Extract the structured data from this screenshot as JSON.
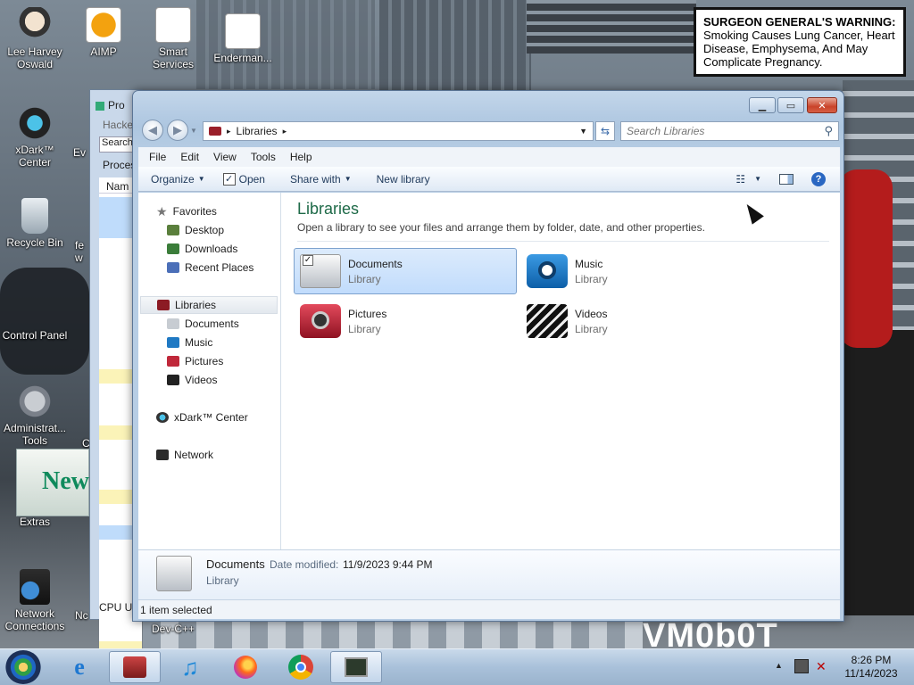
{
  "desktop": {
    "warning_title": "SURGEON GENERAL'S WARNING:",
    "warning_text": "Smoking Causes Lung Cancer, Heart Disease, Emphysema, And May Complicate Pregnancy.",
    "icons": [
      {
        "label": "Lee Harvey Oswald"
      },
      {
        "label": "AIMP"
      },
      {
        "label": "Smart Services"
      },
      {
        "label": "Enderman..."
      },
      {
        "label": "xDark™ Center"
      },
      {
        "label": "Recycle Bin"
      },
      {
        "label": "Control Panel"
      },
      {
        "label": "Administrat... Tools"
      },
      {
        "label": "Extras"
      },
      {
        "label": "Network Connections"
      },
      {
        "label": "Dev-C++"
      }
    ],
    "partial_labels": [
      "Ev",
      "fe",
      "w",
      "C",
      "Nc"
    ],
    "bg_window": {
      "title": "Pro",
      "tab": "Hacke",
      "search": "Search",
      "tab2": "Proces",
      "header": "Nam",
      "status": "CPU Us"
    }
  },
  "explorer": {
    "address": {
      "crumb": "Libraries"
    },
    "search": {
      "placeholder": "Search Libraries"
    },
    "menu": [
      "File",
      "Edit",
      "View",
      "Tools",
      "Help"
    ],
    "commands": {
      "organize": "Organize",
      "open": "Open",
      "share": "Share with",
      "new_library": "New library"
    },
    "nav": {
      "favorites": "Favorites",
      "desktop": "Desktop",
      "downloads": "Downloads",
      "recent": "Recent Places",
      "libraries": "Libraries",
      "documents": "Documents",
      "music": "Music",
      "pictures": "Pictures",
      "videos": "Videos",
      "xdark": "xDark™ Center",
      "network": "Network"
    },
    "content": {
      "title": "Libraries",
      "subtitle": "Open a library to see your files and arrange them by folder, date, and other properties.",
      "items": [
        {
          "name": "Documents",
          "type": "Library"
        },
        {
          "name": "Music",
          "type": "Library"
        },
        {
          "name": "Pictures",
          "type": "Library"
        },
        {
          "name": "Videos",
          "type": "Library"
        }
      ]
    },
    "details": {
      "name": "Documents",
      "modified_label": "Date modified:",
      "modified_value": "11/9/2023 9:44 PM",
      "type": "Library"
    },
    "status": "1 item selected"
  },
  "taskbar": {
    "time": "8:26 PM",
    "date": "11/14/2023"
  },
  "colors": {
    "accent": "#1e5f8a",
    "selection": "#c1dcfc",
    "window_frame": "#adc6e0"
  }
}
